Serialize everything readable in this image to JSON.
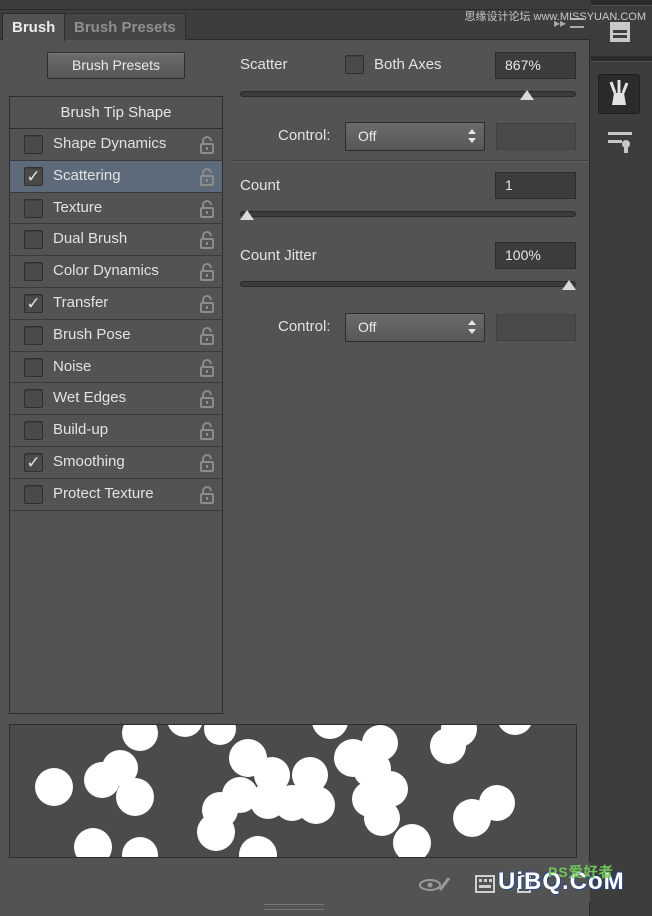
{
  "tabs": [
    {
      "label": "Brush",
      "active": true
    },
    {
      "label": "Brush Presets",
      "active": false
    }
  ],
  "watermark_top": "思缘设计论坛 www.MISSYUAN.COM",
  "presets_button": "Brush Presets",
  "options": {
    "header": "Brush Tip Shape",
    "items": [
      {
        "label": "Shape Dynamics",
        "checked": false,
        "selected": false
      },
      {
        "label": "Scattering",
        "checked": true,
        "selected": true
      },
      {
        "label": "Texture",
        "checked": false,
        "selected": false
      },
      {
        "label": "Dual Brush",
        "checked": false,
        "selected": false
      },
      {
        "label": "Color Dynamics",
        "checked": false,
        "selected": false
      },
      {
        "label": "Transfer",
        "checked": true,
        "selected": false
      },
      {
        "label": "Brush Pose",
        "checked": false,
        "selected": false
      },
      {
        "label": "Noise",
        "checked": false,
        "selected": false
      },
      {
        "label": "Wet Edges",
        "checked": false,
        "selected": false
      },
      {
        "label": "Build-up",
        "checked": false,
        "selected": false
      },
      {
        "label": "Smoothing",
        "checked": true,
        "selected": false
      },
      {
        "label": "Protect Texture",
        "checked": false,
        "selected": false
      }
    ]
  },
  "scatter": {
    "label": "Scatter",
    "both_axes_label": "Both Axes",
    "both_axes_checked": false,
    "value": "867%",
    "slider_fraction": 0.87,
    "control_label": "Control:",
    "control_value": "Off"
  },
  "count": {
    "label": "Count",
    "value": "1",
    "slider_fraction": 0.0
  },
  "count_jitter": {
    "label": "Count Jitter",
    "value": "100%",
    "slider_fraction": 1.0,
    "control_label": "Control:",
    "control_value": "Off"
  },
  "watermark_bottom": {
    "main": "UiBQ.CoM",
    "small": "PS爱好者"
  },
  "colors": {
    "panel": "#535353",
    "selected_row": "#5c6a7a",
    "field": "#3c3c3c",
    "dock": "#3d3d3d"
  }
}
